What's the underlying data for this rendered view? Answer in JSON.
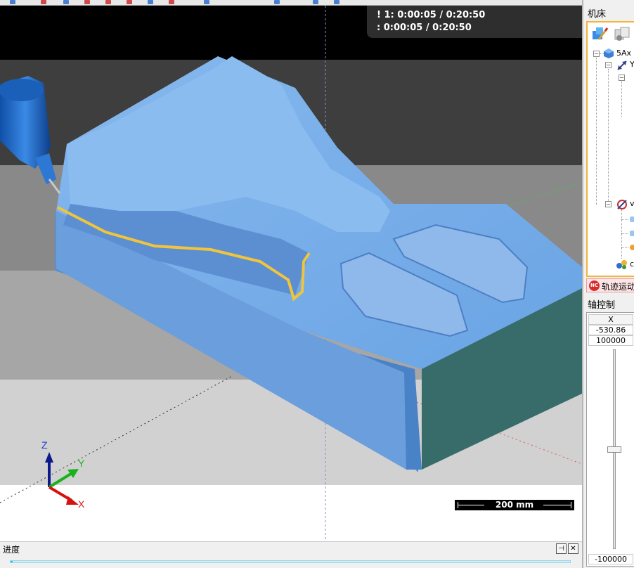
{
  "viewport": {
    "timer_line1": "! 1: 0:00:05 / 0:20:50",
    "timer_line2": ": 0:00:05 / 0:20:50",
    "scale_label": "200 mm",
    "axes": {
      "z": "Z",
      "y": "Y",
      "x": "X"
    },
    "colors": {
      "part": "#6fa8e6",
      "part_side": "#3d6f6a",
      "toolpath": "#f0c43c",
      "tool": "#2270c8"
    }
  },
  "progress_panel": {
    "title": "进度",
    "pin_label": "⊣",
    "close_label": "✕",
    "progress_fraction": 0.004
  },
  "right_panel": {
    "machine_title": "机床",
    "tree": {
      "root_label": "5Ax",
      "node1_label": "Y",
      "node2_label": "v",
      "node3_label": "c"
    },
    "nc_tab": {
      "badge": "NC",
      "label": "轨迹运动"
    },
    "axis_title": "轴控制",
    "axis": {
      "name": "X",
      "value": "-530.86",
      "max": "100000",
      "min": "-100000",
      "slider_fraction": 0.5
    }
  }
}
